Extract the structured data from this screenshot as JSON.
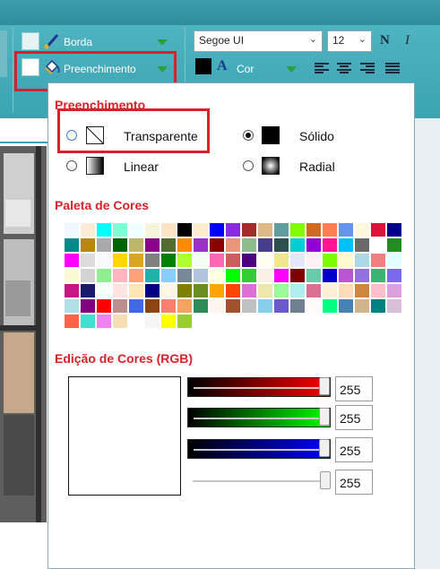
{
  "ribbon": {
    "border_label": "Borda",
    "fill_label": "Preenchimento",
    "font_name": "Segoe UI",
    "font_size": "12",
    "bold_label": "N",
    "italic_label": "I",
    "color_label": "Cor",
    "color_icon": "A"
  },
  "panel": {
    "fill_title": "Preenchimento",
    "options": {
      "transparent": "Transparente",
      "solid": "Sólido",
      "linear": "Linear",
      "radial": "Radial"
    },
    "palette_title": "Paleta de Cores",
    "rgb_title": "Edição de Cores (RGB)",
    "rgb": {
      "red": "255",
      "green": "255",
      "blue": "255",
      "alpha": "255"
    },
    "selected_fill": "Sólido"
  },
  "palette": [
    "#f0f8ff",
    "#faebd7",
    "#00ffff",
    "#7fffd4",
    "#f0ffff",
    "#f5f5dc",
    "#ffe4c4",
    "#000000",
    "#ffebcd",
    "#0000ff",
    "#8a2be2",
    "#a52a2a",
    "#deb887",
    "#5f9ea0",
    "#7fff00",
    "#d2691e",
    "#ff7f50",
    "#6495ed",
    "#fff8dc",
    "#dc143c",
    "#00008b",
    "#008b8b",
    "#b8860b",
    "#a9a9a9",
    "#006400",
    "#bdb76b",
    "#8b008b",
    "#556b2f",
    "#ff8c00",
    "#9932cc",
    "#8b0000",
    "#e9967a",
    "#8fbc8f",
    "#483d8b",
    "#2f4f4f",
    "#00ced1",
    "#9400d3",
    "#ff1493",
    "#00bfff",
    "#696969",
    "#ffffff",
    "#228b22",
    "#ff00ff",
    "#dcdcdc",
    "#f8f8ff",
    "#ffd700",
    "#daa520",
    "#808080",
    "#008000",
    "#adff2f",
    "#f0fff0",
    "#ff69b4",
    "#cd5c5c",
    "#4b0082",
    "#fffff0",
    "#f0e68c",
    "#e6e6fa",
    "#fff0f5",
    "#7cfc00",
    "#fffacd",
    "#add8e6",
    "#f08080",
    "#e0ffff",
    "#fafad2",
    "#d3d3d3",
    "#90ee90",
    "#ffb6c1",
    "#ffa07a",
    "#20b2aa",
    "#87cefa",
    "#778899",
    "#b0c4de",
    "#ffffe0",
    "#00ff00",
    "#32cd32",
    "#faf0e6",
    "#ff00ff",
    "#800000",
    "#66cdaa",
    "#0000cd",
    "#ba55d3",
    "#9370db",
    "#3cb371",
    "#7b68ee",
    "#c71585",
    "#191970",
    "#f5fffa",
    "#ffe4e1",
    "#ffe4b5",
    "#000080",
    "#fdf5e6",
    "#808000",
    "#6b8e23",
    "#ffa500",
    "#ff4500",
    "#da70d6",
    "#eee8aa",
    "#98fb98",
    "#afeeee",
    "#db7093",
    "#ffefd5",
    "#ffdab9",
    "#cd853f",
    "#ffc0cb",
    "#dda0dd",
    "#b0e0e6",
    "#800080",
    "#ff0000",
    "#bc8f8f",
    "#4169e1",
    "#8b4513",
    "#fa8072",
    "#f4a460",
    "#2e8b57",
    "#fff5ee",
    "#a0522d",
    "#c0c0c0",
    "#87ceeb",
    "#6a5acd",
    "#708090",
    "#fffafa",
    "#00ff7f",
    "#4682b4",
    "#d2b48c",
    "#008080",
    "#d8bfd8",
    "#ff6347",
    "#40e0d0",
    "#ee82ee",
    "#f5deb3",
    "#ffffff",
    "#f5f5f5",
    "#ffff00",
    "#9acd32"
  ]
}
